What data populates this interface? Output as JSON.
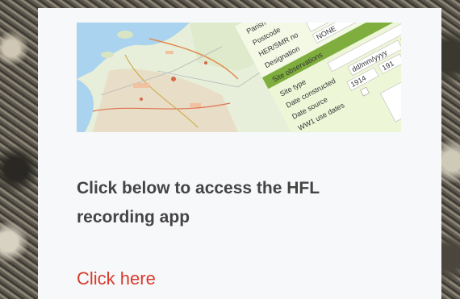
{
  "card": {
    "heading": "Click below to access the HFL recording app",
    "link_label": "Click here"
  },
  "thumbnail": {
    "form_labels": [
      "Parish",
      "Postcode",
      "HER/SMR no",
      "Designation",
      "Site observations",
      "Site type",
      "Date constructed",
      "Date source",
      "WW1 use dates"
    ],
    "designation_value": "NONE",
    "date_placeholder": "dd/mm/yyyy",
    "date_source_value": "1914",
    "year_value": "191"
  },
  "colors": {
    "link": "#d93a2b",
    "heading": "#444444",
    "card_background": "#f7f8fa",
    "form_green": "#d6ec9c",
    "form_dark_green": "#7fae3e"
  }
}
